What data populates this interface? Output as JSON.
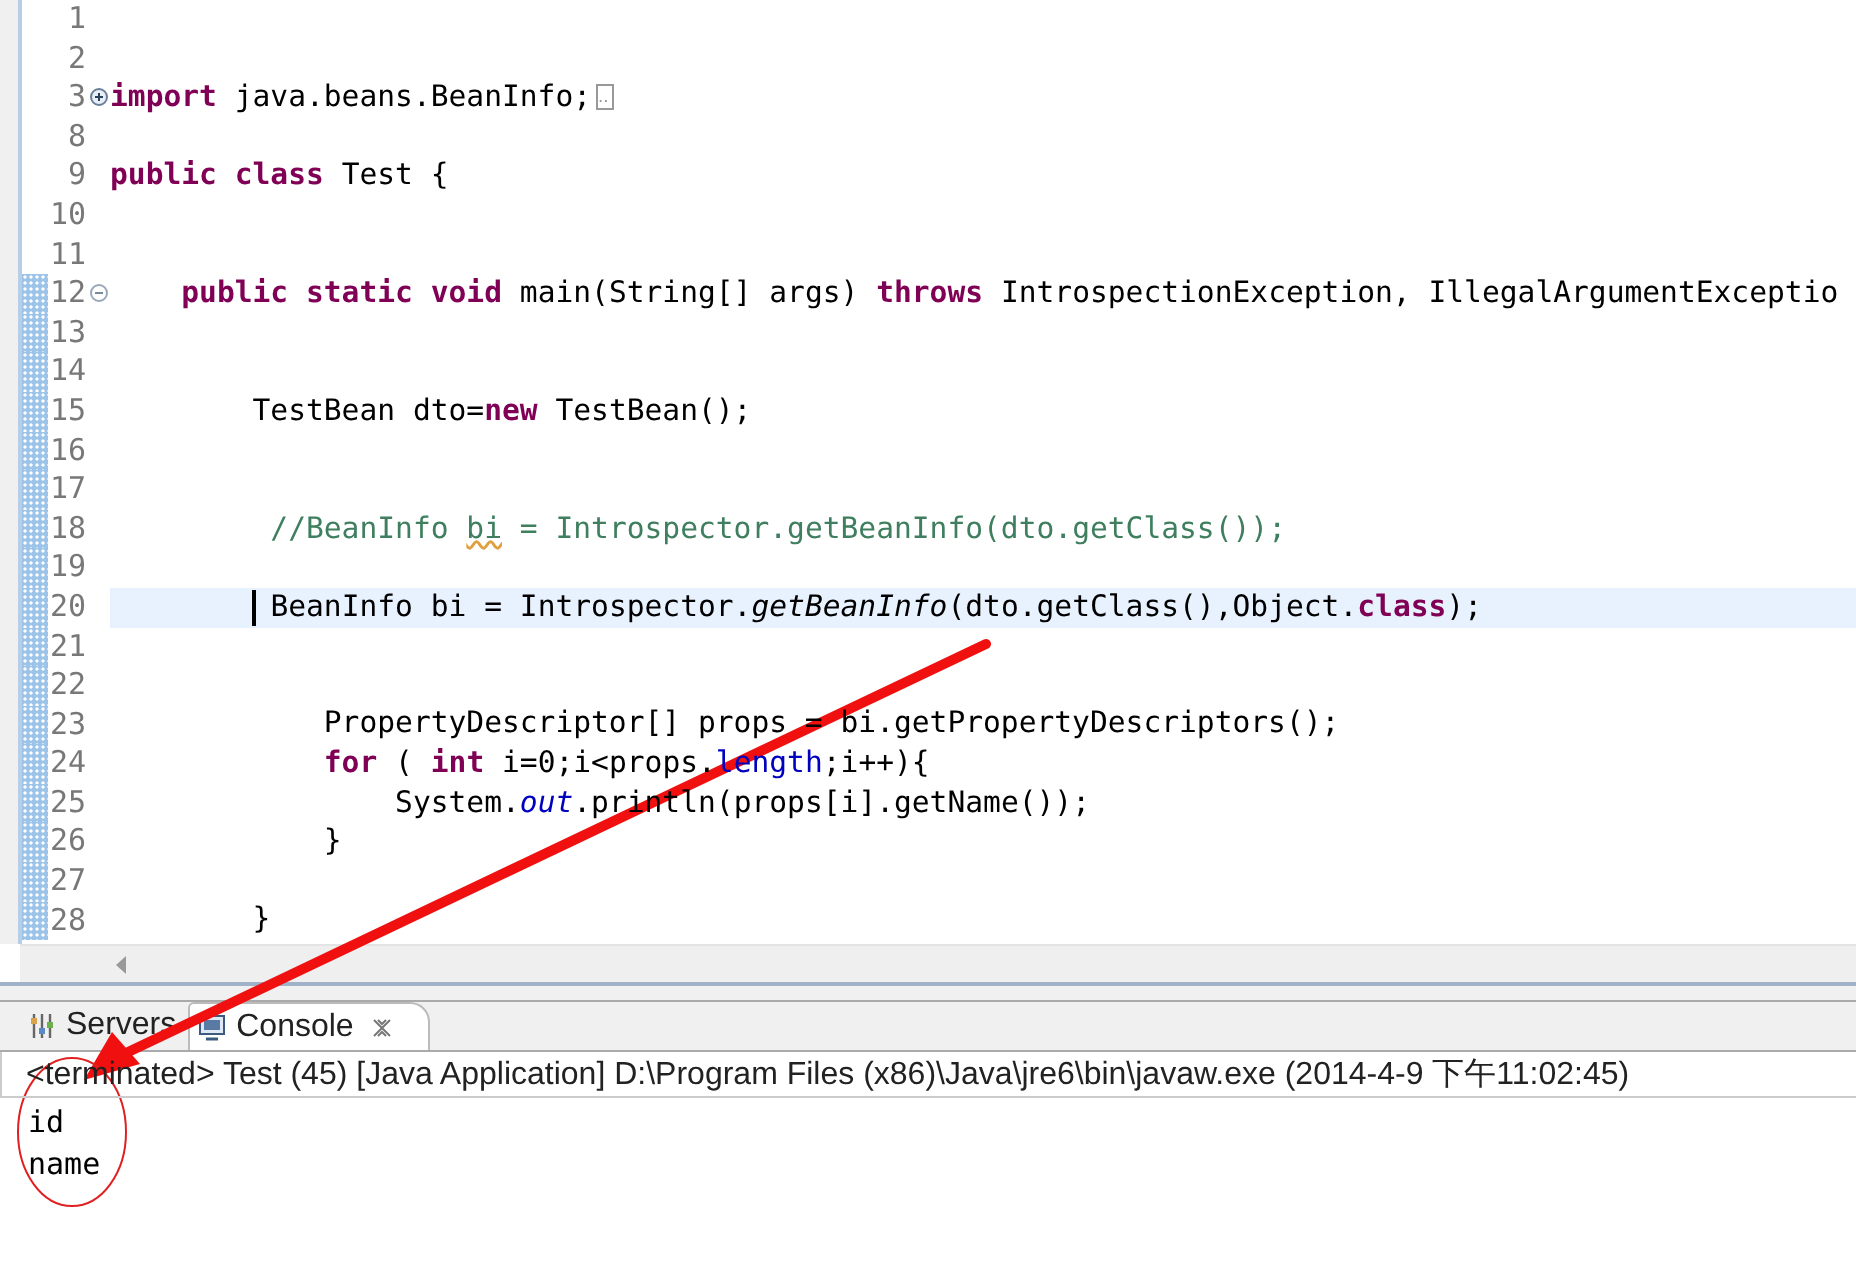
{
  "editor": {
    "lines": [
      {
        "number": "1",
        "changed": false
      },
      {
        "number": "2",
        "changed": false
      },
      {
        "number": "3",
        "changed": false,
        "collapsed": true,
        "tokens": [
          {
            "kind": "keyword",
            "text": "import"
          },
          {
            "kind": "plain",
            "text": " java.beans.BeanInfo;"
          }
        ]
      },
      {
        "number": "8",
        "changed": false
      },
      {
        "number": "9",
        "changed": false,
        "tokens": [
          {
            "kind": "keyword",
            "text": "public class"
          },
          {
            "kind": "plain",
            "text": " Test {"
          }
        ]
      },
      {
        "number": "10",
        "changed": false
      },
      {
        "number": "11",
        "changed": false
      },
      {
        "number": "12",
        "changed": true,
        "collapsed": false,
        "tokens": [
          {
            "kind": "keyword",
            "text": "    public static void"
          },
          {
            "kind": "plain",
            "text": " main(String[] args) "
          },
          {
            "kind": "keyword",
            "text": "throws"
          },
          {
            "kind": "plain",
            "text": " IntrospectionException, IllegalArgumentExceptio"
          }
        ]
      },
      {
        "number": "13",
        "changed": true
      },
      {
        "number": "14",
        "changed": true
      },
      {
        "number": "15",
        "changed": true,
        "tokens": [
          {
            "kind": "plain",
            "text": "        TestBean dto="
          },
          {
            "kind": "keyword",
            "text": "new"
          },
          {
            "kind": "plain",
            "text": " TestBean();"
          }
        ]
      },
      {
        "number": "16",
        "changed": true
      },
      {
        "number": "17",
        "changed": true
      },
      {
        "number": "18",
        "changed": true,
        "tokens": [
          {
            "kind": "comment",
            "text": "         //BeanInfo "
          },
          {
            "kind": "misspelled",
            "text": "bi"
          },
          {
            "kind": "comment",
            "text": " = Introspector.getBeanInfo(dto.getClass());"
          }
        ]
      },
      {
        "number": "19",
        "changed": true
      },
      {
        "number": "20",
        "changed": true,
        "current": true,
        "caret": true,
        "tokens": [
          {
            "kind": "plain",
            "text": "         BeanInfo bi = Introspector."
          },
          {
            "kind": "static",
            "text": "getBeanInfo"
          },
          {
            "kind": "plain",
            "text": "(dto.getClass(),Object."
          },
          {
            "kind": "keyword",
            "text": "class"
          },
          {
            "kind": "plain",
            "text": ");"
          }
        ]
      },
      {
        "number": "21",
        "changed": true
      },
      {
        "number": "22",
        "changed": true
      },
      {
        "number": "23",
        "changed": true,
        "tokens": [
          {
            "kind": "plain",
            "text": "            PropertyDescriptor[] props = bi.getPropertyDescriptors();"
          }
        ]
      },
      {
        "number": "24",
        "changed": true,
        "tokens": [
          {
            "kind": "keyword",
            "text": "            for"
          },
          {
            "kind": "plain",
            "text": " ( "
          },
          {
            "kind": "keyword",
            "text": "int"
          },
          {
            "kind": "plain",
            "text": " i=0;i<props."
          },
          {
            "kind": "field",
            "text": "length"
          },
          {
            "kind": "plain",
            "text": ";i++){"
          }
        ]
      },
      {
        "number": "25",
        "changed": true,
        "tokens": [
          {
            "kind": "plain",
            "text": "                System."
          },
          {
            "kind": "static-field",
            "text": "out"
          },
          {
            "kind": "plain",
            "text": ".println(props[i].getName());"
          }
        ]
      },
      {
        "number": "26",
        "changed": true,
        "tokens": [
          {
            "kind": "plain",
            "text": "            }"
          }
        ]
      },
      {
        "number": "27",
        "changed": true
      },
      {
        "number": "28",
        "changed": true,
        "tokens": [
          {
            "kind": "plain",
            "text": "        }"
          }
        ]
      }
    ]
  },
  "console": {
    "tabs": [
      {
        "kind": "servers",
        "label": "Servers",
        "selected": false,
        "closable": false
      },
      {
        "kind": "console",
        "label": "Console",
        "selected": true,
        "closable": true
      }
    ],
    "header": "<terminated> Test (45) [Java Application] D:\\Program Files (x86)\\Java\\jre6\\bin\\javaw.exe (2014-4-9 下午11:02:45)",
    "output": [
      "id",
      "name"
    ]
  }
}
